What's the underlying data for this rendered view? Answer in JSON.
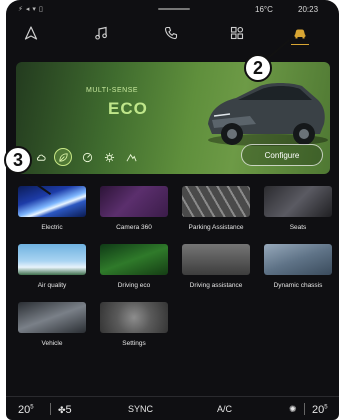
{
  "status": {
    "temperature": "16°C",
    "clock": "20:23"
  },
  "nav": {
    "items": [
      {
        "name": "navigation-icon"
      },
      {
        "name": "music-icon"
      },
      {
        "name": "phone-icon"
      },
      {
        "name": "apps-icon"
      },
      {
        "name": "car-icon",
        "active": true
      }
    ]
  },
  "hero": {
    "subtitle": "MULTI-SENSE",
    "title": "ECO",
    "configure_label": "Configure",
    "modes": [
      "comfort-mode-icon",
      "eco-mode-icon",
      "sport-mode-icon",
      "perso-mode-icon",
      "mountain-mode-icon"
    ],
    "selected_mode": 1,
    "accent": "#bfe68a"
  },
  "tiles": [
    {
      "label": "Electric"
    },
    {
      "label": "Camera 360"
    },
    {
      "label": "Parking Assistance"
    },
    {
      "label": "Seats"
    },
    {
      "label": "Air quality"
    },
    {
      "label": "Driving eco"
    },
    {
      "label": "Driving assistance"
    },
    {
      "label": "Dynamic chassis"
    },
    {
      "label": "Vehicle"
    },
    {
      "label": "Settings"
    }
  ],
  "callouts": {
    "one": "2",
    "two": "3"
  },
  "bottom": {
    "left_temp": "20",
    "left_temp_suffix": "5",
    "fan_level": "5",
    "sync": "SYNC",
    "ac": "A/C",
    "right_temp": "20",
    "right_temp_suffix": "5"
  }
}
